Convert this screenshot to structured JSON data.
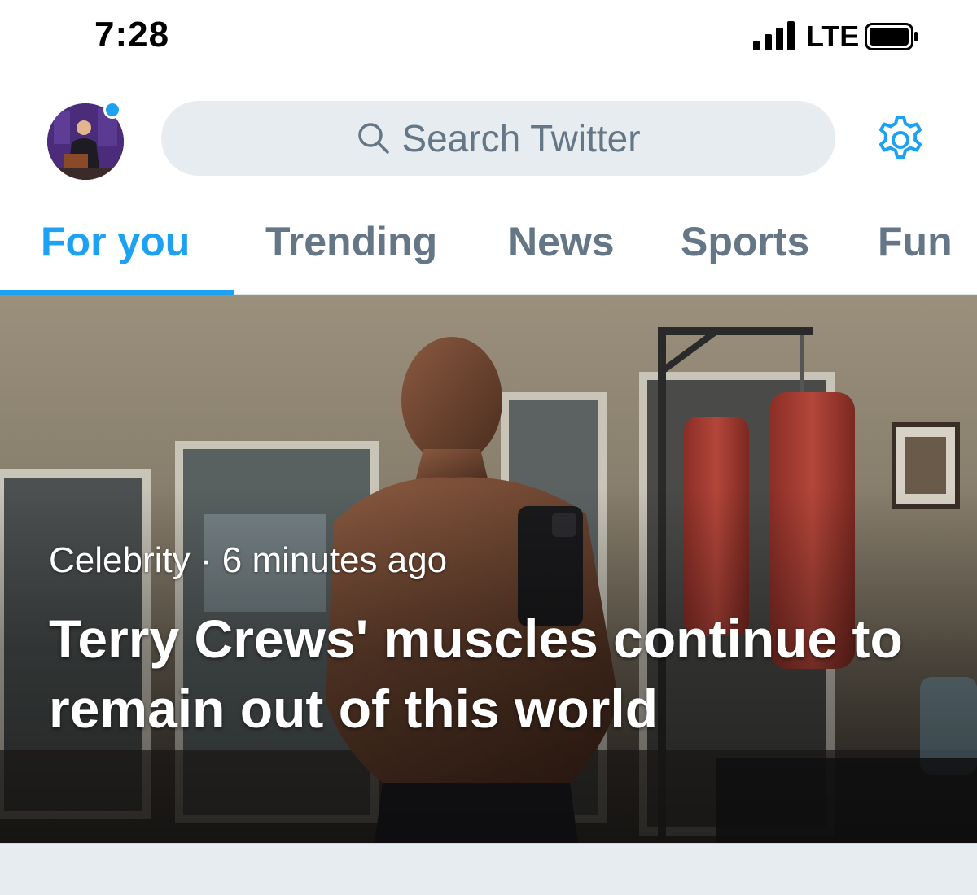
{
  "status_bar": {
    "time": "7:28",
    "network": "LTE"
  },
  "header": {
    "search_placeholder": "Search Twitter",
    "avatar_icon": "profile-avatar",
    "settings_icon": "gear-icon",
    "notification_dot_color": "#1da1f2"
  },
  "tabs": [
    {
      "label": "For you",
      "active": true
    },
    {
      "label": "Trending",
      "active": false
    },
    {
      "label": "News",
      "active": false
    },
    {
      "label": "Sports",
      "active": false
    },
    {
      "label": "Fun",
      "active": false
    }
  ],
  "hero": {
    "category": "Celebrity",
    "separator": "·",
    "time_ago": "6 minutes ago",
    "title": "Terry Crews' muscles continue to remain out of this world"
  },
  "colors": {
    "accent": "#1da1f2",
    "tab_inactive": "#657786",
    "search_bg": "#e6ecf0"
  }
}
